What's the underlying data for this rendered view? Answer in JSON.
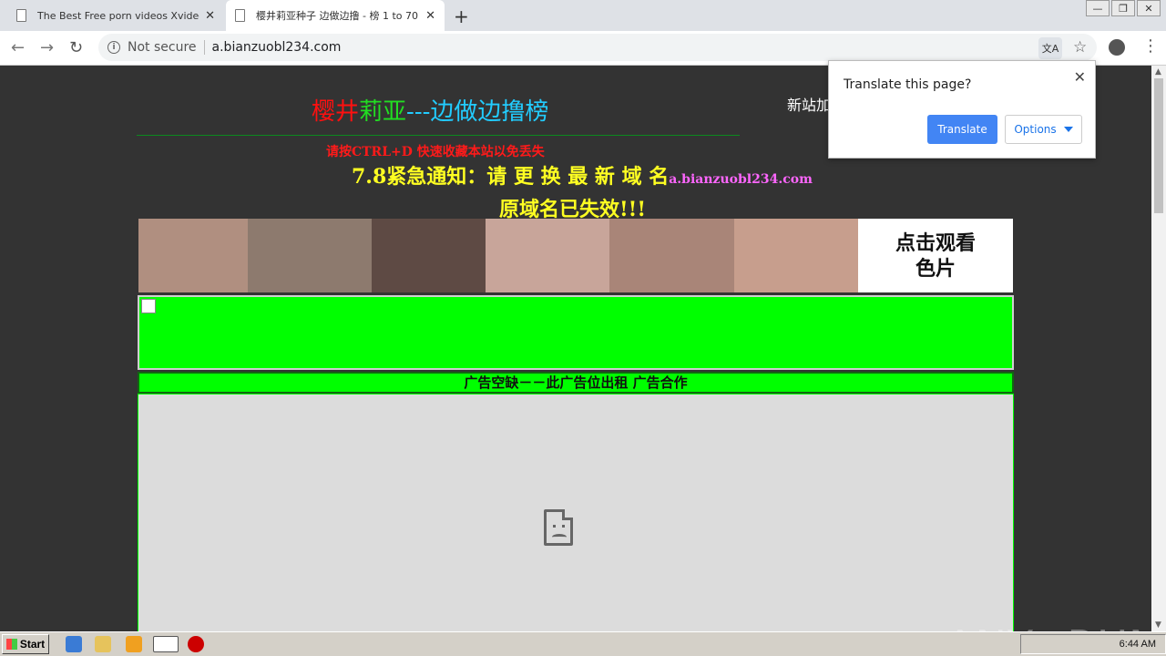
{
  "tabs": [
    {
      "title": "The Best Free porn videos Xvideos",
      "active": false
    },
    {
      "title": "樱井莉亚种子 边做边撸 - 榜 1 to 70",
      "active": true
    }
  ],
  "address": {
    "security": "Not secure",
    "url": "a.bianzuobl234.com"
  },
  "site": {
    "title_part1": "樱井",
    "title_part2": "莉亚",
    "title_part3": "---边做边撸榜",
    "ctrl_d": "请按CTRL+D 快速收藏本站以免丢失",
    "notice1": "7.8紧急通知：请 更 换 最 新 域 名",
    "notice1_domain": "a.bianzuobl234.com",
    "notice2": "原域名已失效!!!",
    "new_site": "新站加",
    "cta_line1": "点击观看",
    "cta_line2": "色片",
    "ad_text": "广告空缺－－此广告位出租 广告合作"
  },
  "translate_popup": {
    "question": "Translate this page?",
    "translate_label": "Translate",
    "options_label": "Options"
  },
  "taskbar": {
    "start_label": "Start",
    "clock": "6:44 AM"
  },
  "watermark": "ANY▷RUN",
  "thumb_colors": [
    "#b08f80",
    "#8d7a6e",
    "#5e4a44",
    "#c8a59a",
    "#a98578",
    "#c79e8d"
  ]
}
